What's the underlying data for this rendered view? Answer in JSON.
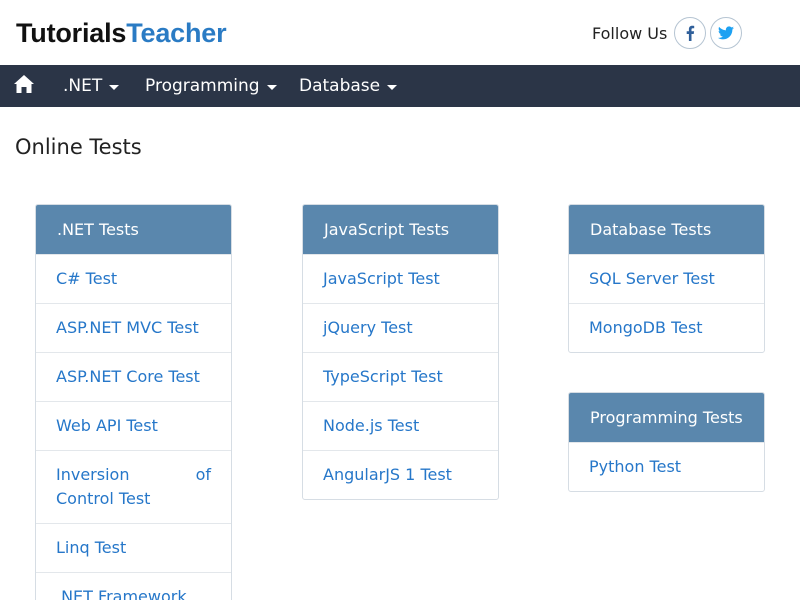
{
  "header": {
    "logo_part1": "Tutorials",
    "logo_part2": "Teacher",
    "follow_text": "Follow Us"
  },
  "nav": {
    "items": [
      {
        "label": ".NET"
      },
      {
        "label": "Programming"
      },
      {
        "label": "Database"
      }
    ]
  },
  "page": {
    "title": "Online Tests"
  },
  "cards": [
    {
      "title": ".NET Tests",
      "items": [
        "C# Test",
        "ASP.NET MVC Test",
        "ASP.NET Core Test",
        "Web API Test",
        "Inversion of Control Test",
        "Linq Test",
        ".NET Framework"
      ]
    },
    {
      "title": "JavaScript Tests",
      "items": [
        "JavaScript Test",
        "jQuery Test",
        "TypeScript Test",
        "Node.js Test",
        "AngularJS 1 Test"
      ]
    },
    {
      "title": "Database Tests",
      "items": [
        "SQL Server Test",
        "MongoDB Test"
      ]
    },
    {
      "title": "Programming Tests",
      "items": [
        "Python Test"
      ]
    }
  ],
  "colors": {
    "brand_blue": "#2a7bc4",
    "nav_bg": "#2b3547",
    "card_header": "#5a87ad",
    "link": "#2677c9"
  },
  "icons": [
    "home-icon",
    "facebook-icon",
    "twitter-icon",
    "caret-down-icon"
  ]
}
